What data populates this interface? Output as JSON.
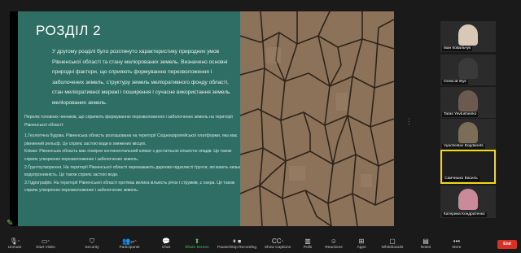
{
  "slide": {
    "title": "РОЗДІЛ 2",
    "intro": "У другому розділі було розглянуто характеристику природних умов Рівненської області та стану меліорованих земель. Визначено основні природні фактори, що сприяють формуванню перезволоження і заболочених земель, структуру земель меліоративного фонду області, стан меліоративної мережі і поширення і сучасне використання земель меліорованих земель.",
    "body": [
      "Перелік головних чинників, що сприяють формуванню перезволоження і заболочених земель на території Рівненської області:",
      "1.Геологічна будова. Рівненська область розташована на території Східноєвропейської платформи, яка має рівнинний рельєф. Це сприяє застою води в знижених місцях.",
      "Клімат. Рівненська область має помірно континентальний клімат з достатньою кількістю опадів. Це також сприяє утворенню перезволожених і заболочених земель.",
      "2.Ґрунтоутворення. На території Рівненської області переважають дерново-підзолисті ґрунти, які мають низьку водопроникність. Це також сприяє застою води.",
      "3.Гідрографія. На території Рівненської області протікає велика кількість річок і струмків, є озера. Це також сприяє утворенню перезволожених і заболочених земель."
    ]
  },
  "participants": [
    {
      "name": "Іван Ковальчук",
      "color": "#d9c8b6"
    },
    {
      "name": "Олексій Жук",
      "color": "#3a3a3a"
    },
    {
      "name": "Taras Yevtushenko",
      "color": "#6b5a4d"
    },
    {
      "name": "Vyacheslav Bogdanets",
      "color": "#7c6d58"
    },
    {
      "name": "Самчишко Василь",
      "color": "#1e1e1e"
    },
    {
      "name": "Катерина Кондратенко",
      "color": "#c98a9a"
    }
  ],
  "toolbar": {
    "unmute": "Unmute",
    "start_video": "Start Video",
    "security": "Security",
    "participants": "Participants",
    "participants_count": "27",
    "chat": "Chat",
    "share_screen": "Share Screen",
    "recording": "Pause/Stop Recording",
    "captions": "Show Captions",
    "polls": "Polls",
    "reactions": "Reactions",
    "apps": "Apps",
    "whiteboards": "Whiteboards",
    "notes": "Notes",
    "more": "More",
    "end": "End"
  }
}
